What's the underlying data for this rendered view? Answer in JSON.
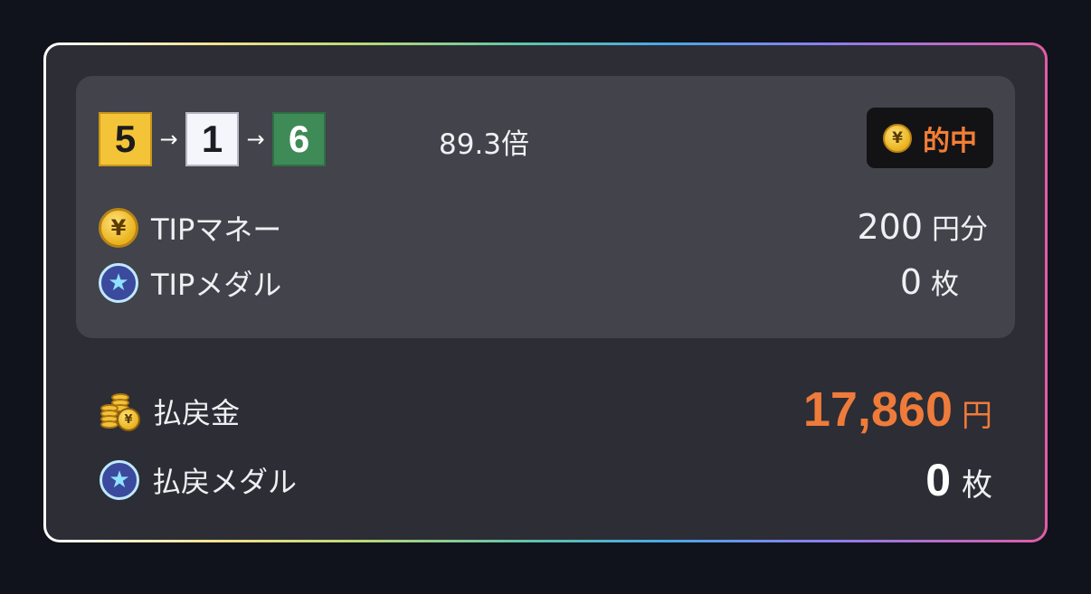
{
  "bet": {
    "combination": [
      "5",
      "1",
      "6"
    ],
    "arrow": "→",
    "odds": "89.3倍",
    "result_badge": {
      "icon_symbol": "¥",
      "label": "的中"
    }
  },
  "tip": {
    "money": {
      "icon": "yen-coin-icon",
      "icon_symbol": "¥",
      "label": "TIPマネー",
      "value": "200",
      "unit": "円分"
    },
    "medal": {
      "icon": "star-medal-icon",
      "icon_symbol": "★",
      "label": "TIPメダル",
      "value": "0",
      "unit": "枚"
    }
  },
  "payout": {
    "money": {
      "icon": "coin-stack-icon",
      "icon_symbol": "¥",
      "label": "払戻金",
      "value": "17,860",
      "unit": "円"
    },
    "medal": {
      "icon": "star-medal-icon",
      "icon_symbol": "★",
      "label": "払戻メダル",
      "value": "0",
      "unit": "枚"
    }
  },
  "colors": {
    "accent": "#ef7b3a",
    "boat_5": "#f3c437",
    "boat_1": "#f5f6fb",
    "boat_6": "#3f8b58",
    "card_bg": "#2c2d35",
    "panel_bg": "#42434b"
  }
}
